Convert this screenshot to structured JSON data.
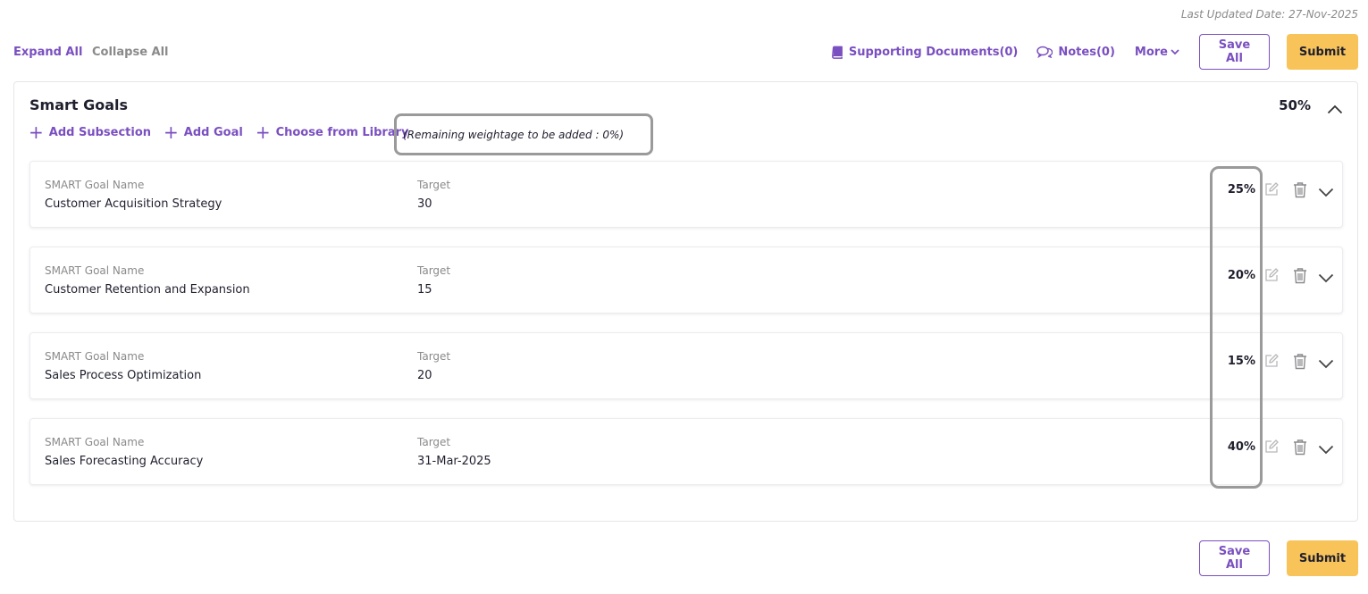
{
  "last_updated": "Last Updated Date: 27-Nov-2025",
  "expand_all": "Expand All",
  "collapse_all": "Collapse All",
  "toolbar": {
    "supporting_documents": "Supporting Documents(0)",
    "notes": "Notes(0)",
    "more": "More",
    "save_all": "Save All",
    "submit": "Submit"
  },
  "section": {
    "title": "Smart Goals",
    "weight": "50%",
    "actions": {
      "add_subsection": "Add Subsection",
      "add_goal": "Add Goal",
      "choose_from_library": "Choose from Library"
    },
    "remaining": "(Remaining weightage to be added : 0%)",
    "goals": [
      {
        "name_label": "SMART Goal Name",
        "name": "Customer Acquisition Strategy",
        "target_label": "Target",
        "target": "30",
        "weight": "25%"
      },
      {
        "name_label": "SMART Goal Name",
        "name": "Customer Retention and Expansion",
        "target_label": "Target",
        "target": "15",
        "weight": "20%"
      },
      {
        "name_label": "SMART Goal Name",
        "name": "Sales Process Optimization",
        "target_label": "Target",
        "target": "20",
        "weight": "15%"
      },
      {
        "name_label": "SMART Goal Name",
        "name": "Sales Forecasting Accuracy",
        "target_label": "Target",
        "target": "31-Mar-2025",
        "weight": "40%"
      }
    ]
  },
  "colors": {
    "accent": "#7a4fc0",
    "submit": "#f8c45a",
    "muted": "#8a8a8a",
    "highlight": "#9a9a9a"
  },
  "icons": {
    "supporting_documents": "book-icon",
    "notes": "speech-bubbles-icon",
    "more": "chevron-down-icon",
    "section_collapse": "chevron-up-icon",
    "edit": "pencil-icon",
    "delete": "trash-icon",
    "expand": "chevron-down-icon"
  }
}
